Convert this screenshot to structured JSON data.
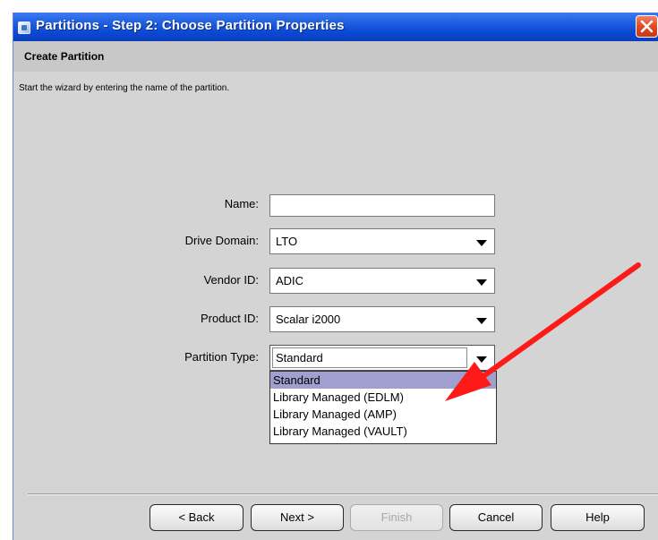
{
  "window": {
    "title": "Partitions - Step 2: Choose Partition Properties"
  },
  "section": {
    "title": "Create Partition",
    "instruction": "Start the wizard by entering the name of the partition."
  },
  "form": {
    "name": {
      "label": "Name:",
      "value": ""
    },
    "drive_domain": {
      "label": "Drive Domain:",
      "value": "LTO"
    },
    "vendor_id": {
      "label": "Vendor ID:",
      "value": "ADIC"
    },
    "product_id": {
      "label": "Product ID:",
      "value": "Scalar i2000"
    },
    "partition_type": {
      "label": "Partition Type:",
      "value": "Standard",
      "options": [
        "Standard",
        "Library Managed (EDLM)",
        "Library Managed (AMP)",
        "Library Managed (VAULT)"
      ],
      "highlighted_option": "Standard"
    }
  },
  "buttons": {
    "back": "< Back",
    "next": "Next >",
    "finish": "Finish",
    "cancel": "Cancel",
    "help": "Help"
  },
  "colors": {
    "titlebar": "#0a48d6",
    "dialog_background": "#d4d4d4",
    "selection_highlight": "#9fa0d0",
    "annotation_arrow": "#ff1a1a",
    "close_button": "#e04a23"
  },
  "icons": {
    "title": "application-icon",
    "close": "close-icon",
    "dropdown": "chevron-down-icon",
    "annotation": "red-arrow-icon"
  }
}
